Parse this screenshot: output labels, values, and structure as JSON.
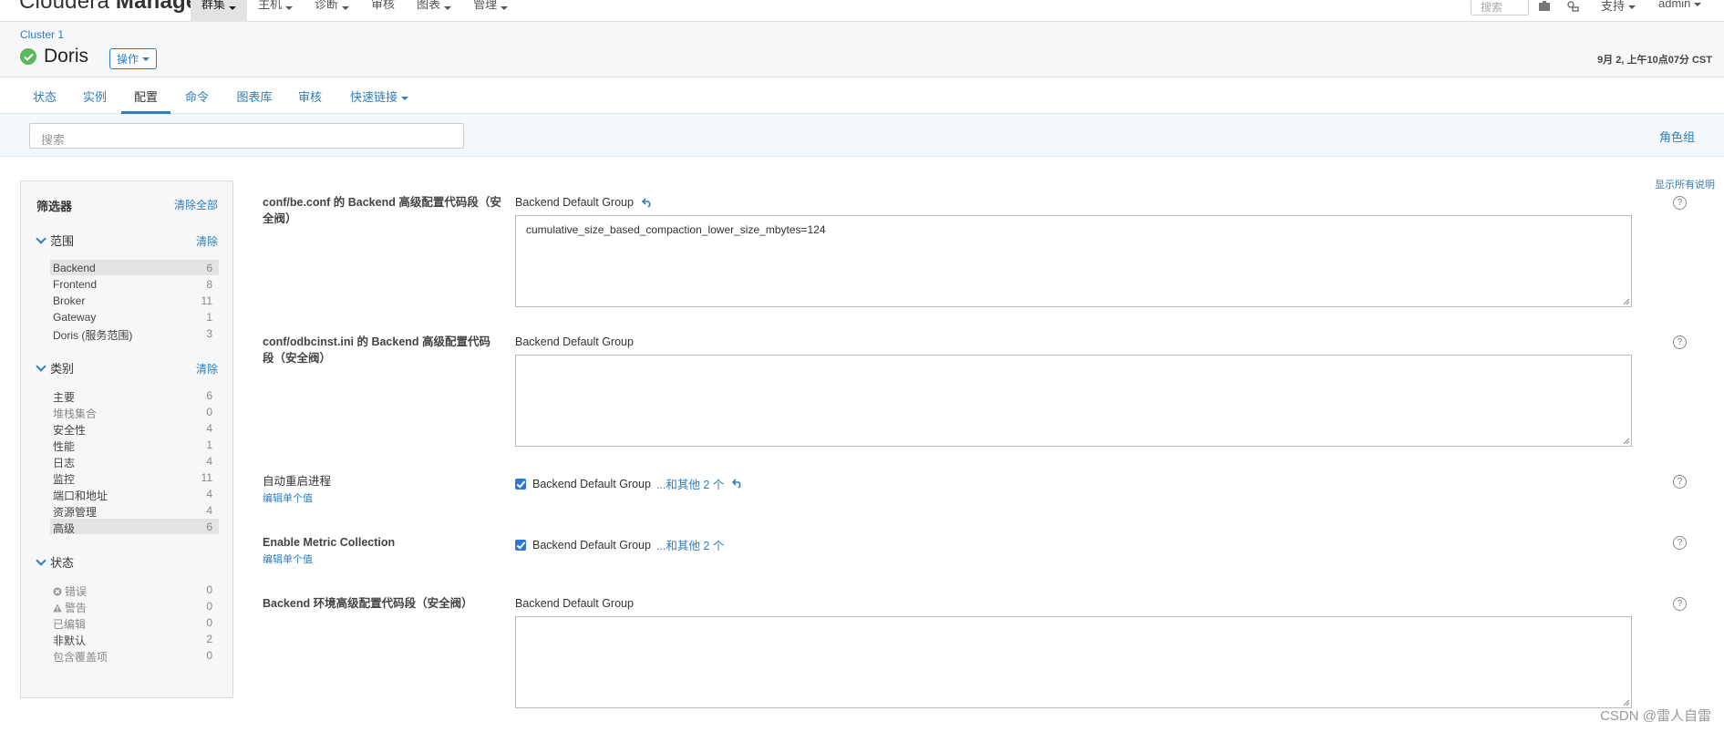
{
  "topnav": {
    "brand_light": "Cloudera",
    "brand_bold": "Manager",
    "items": [
      {
        "label": "群集",
        "dropdown": true,
        "active": true
      },
      {
        "label": "主机",
        "dropdown": true,
        "active": false
      },
      {
        "label": "诊断",
        "dropdown": true,
        "active": false
      },
      {
        "label": "审核",
        "dropdown": false,
        "active": false
      },
      {
        "label": "图表",
        "dropdown": true,
        "active": false
      },
      {
        "label": "管理",
        "dropdown": true,
        "active": false
      }
    ],
    "search_placeholder": "搜索",
    "support_label": "支持",
    "user_label": "admin"
  },
  "header": {
    "breadcrumb": "Cluster 1",
    "service_name": "Doris",
    "actions_label": "操作",
    "timestamp": "9月 2, 上午10点07分 CST",
    "status_color": "#5cb85c"
  },
  "tabs": [
    {
      "label": "状态",
      "active": false
    },
    {
      "label": "实例",
      "active": false
    },
    {
      "label": "配置",
      "active": true
    },
    {
      "label": "命令",
      "active": false
    },
    {
      "label": "图表库",
      "active": false
    },
    {
      "label": "审核",
      "active": false
    },
    {
      "label": "快速链接",
      "active": false,
      "dropdown": true
    }
  ],
  "search": {
    "placeholder": "搜索",
    "role_groups_label": "角色组"
  },
  "filters": {
    "title": "筛选器",
    "clear_all": "清除全部",
    "scope": {
      "title": "范围",
      "clear": "清除",
      "items": [
        {
          "label": "Backend",
          "count": "6",
          "selected": true
        },
        {
          "label": "Frontend",
          "count": "8"
        },
        {
          "label": "Broker",
          "count": "11"
        },
        {
          "label": "Gateway",
          "count": "1"
        },
        {
          "label": "Doris (服务范围)",
          "count": "3"
        }
      ]
    },
    "category": {
      "title": "类别",
      "clear": "清除",
      "items": [
        {
          "label": "主要",
          "count": "6"
        },
        {
          "label": "堆栈集合",
          "count": "0",
          "muted": true
        },
        {
          "label": "安全性",
          "count": "4"
        },
        {
          "label": "性能",
          "count": "1"
        },
        {
          "label": "日志",
          "count": "4"
        },
        {
          "label": "监控",
          "count": "11"
        },
        {
          "label": "端口和地址",
          "count": "4"
        },
        {
          "label": "资源管理",
          "count": "4"
        },
        {
          "label": "高级",
          "count": "6",
          "selected": true
        }
      ]
    },
    "status": {
      "title": "状态",
      "items": [
        {
          "label": "错误",
          "count": "0",
          "muted": true,
          "icon": "error-icon"
        },
        {
          "label": "警告",
          "count": "0",
          "muted": true,
          "icon": "warning-icon"
        },
        {
          "label": "已编辑",
          "count": "0",
          "muted": true
        },
        {
          "label": "非默认",
          "count": "2"
        },
        {
          "label": "包含覆盖项",
          "count": "0",
          "muted": true
        }
      ]
    }
  },
  "show_all_descriptions": "显示所有说明",
  "configs": [
    {
      "label": "conf/be.conf 的 Backend 高级配置代码段（安全阀）",
      "group": "Backend Default Group",
      "value": "cumulative_size_based_compaction_lower_size_mbytes=124",
      "undo": true
    },
    {
      "label": "conf/odbcinst.ini 的 Backend 高级配置代码段（安全阀）",
      "group": "Backend Default Group",
      "value": ""
    },
    {
      "label": "自动重启进程",
      "edit_link": "编辑单个值",
      "group": "Backend Default Group",
      "more": "...和其他 2 个",
      "checked": true,
      "undo": true
    },
    {
      "label": "Enable Metric Collection",
      "edit_link": "编辑单个值",
      "group": "Backend Default Group",
      "more": "...和其他 2 个",
      "checked": true
    },
    {
      "label": "Backend 环境高级配置代码段（安全阀）",
      "group": "Backend Default Group",
      "value": ""
    }
  ],
  "help_glyph": "?",
  "watermark": "CSDN @雷人自雷"
}
